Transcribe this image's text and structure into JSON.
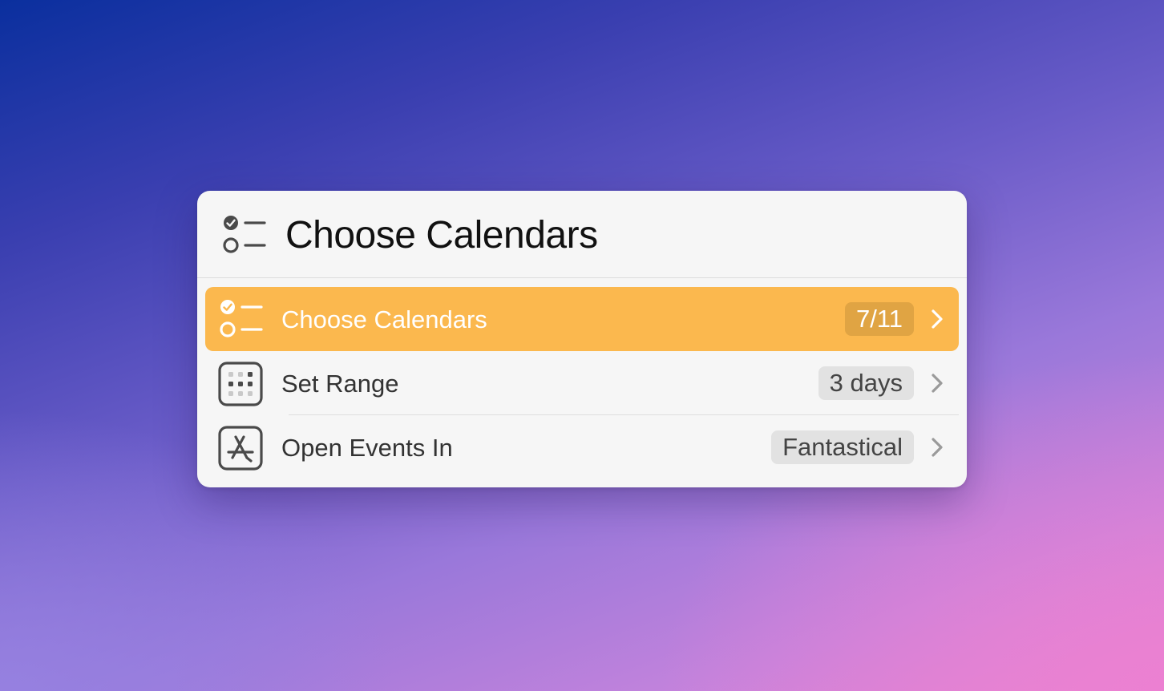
{
  "header": {
    "title": "Choose Calendars",
    "icon": "checklist-icon"
  },
  "rows": [
    {
      "label": "Choose Calendars",
      "value": "7/11",
      "icon": "checklist-icon",
      "selected": true
    },
    {
      "label": "Set Range",
      "value": "3 days",
      "icon": "calendar-grid-icon",
      "selected": false
    },
    {
      "label": "Open Events In",
      "value": "Fantastical",
      "icon": "app-store-icon",
      "selected": false
    }
  ],
  "colors": {
    "accent": "#fbb84e",
    "panel": "#f6f6f6"
  }
}
